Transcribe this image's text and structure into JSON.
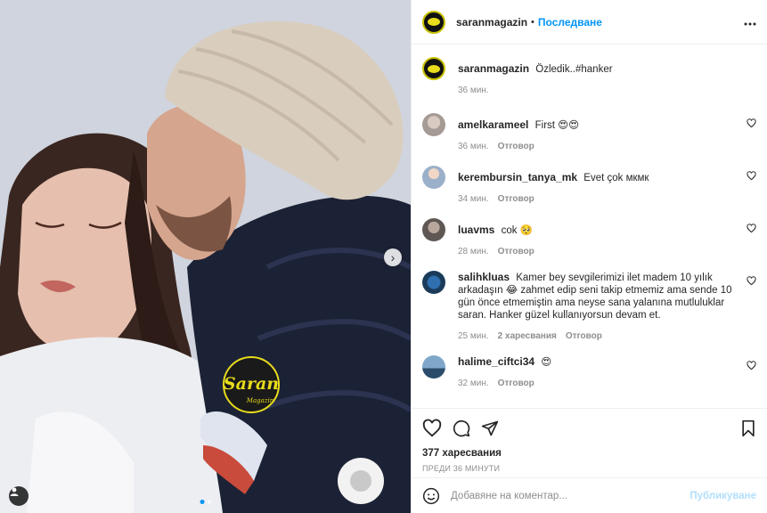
{
  "post": {
    "author": "saranmagazin",
    "separator": "•",
    "follow_label": "Последване",
    "more_icon": "more-horizontal-icon",
    "watermark_brand": "Saran",
    "watermark_sub": "Magazin"
  },
  "caption": {
    "user": "saranmagazin",
    "text": "Özledik..#hanker",
    "time": "36 мин."
  },
  "comments": [
    {
      "user": "amelkarameel",
      "text": "First 😍😍",
      "time": "36 мин.",
      "reply_label": "Отговор",
      "likes": ""
    },
    {
      "user": "kerembursin_tanya_mk",
      "text": "Evet çok мкмк",
      "time": "34 мин.",
      "reply_label": "Отговор",
      "likes": ""
    },
    {
      "user": "luavms",
      "text": "cok 🥺",
      "time": "28 мин.",
      "reply_label": "Отговор",
      "likes": ""
    },
    {
      "user": "salihkluas",
      "text": "Kamer bey sevgilerimizi ilet madem 10 yılık arkadaşın 😂 zahmet edip seni takip etmemiz ama sende 10 gün önce etmemiştin ama neyse sana yalanına mutluluklar saran. Hanker güzel kullanıyorsun devam et.",
      "time": "25 мин.",
      "reply_label": "Отговор",
      "likes": "2 харесвания"
    },
    {
      "user": "halime_ciftci34",
      "text": "😍",
      "time": "32 мин.",
      "reply_label": "Отговор",
      "likes": ""
    }
  ],
  "stats": {
    "likes": "377 харесвания",
    "ago": "ПРЕДИ 36 МИНУТИ"
  },
  "composer": {
    "placeholder": "Добавяне на коментар...",
    "publish_label": "Публикуване"
  },
  "carousel": {
    "total": 2,
    "current": 1
  },
  "colors": {
    "accent": "#0095f6",
    "publish_disabled": "#b2dffc",
    "brand_yellow": "#e8dc1c"
  }
}
